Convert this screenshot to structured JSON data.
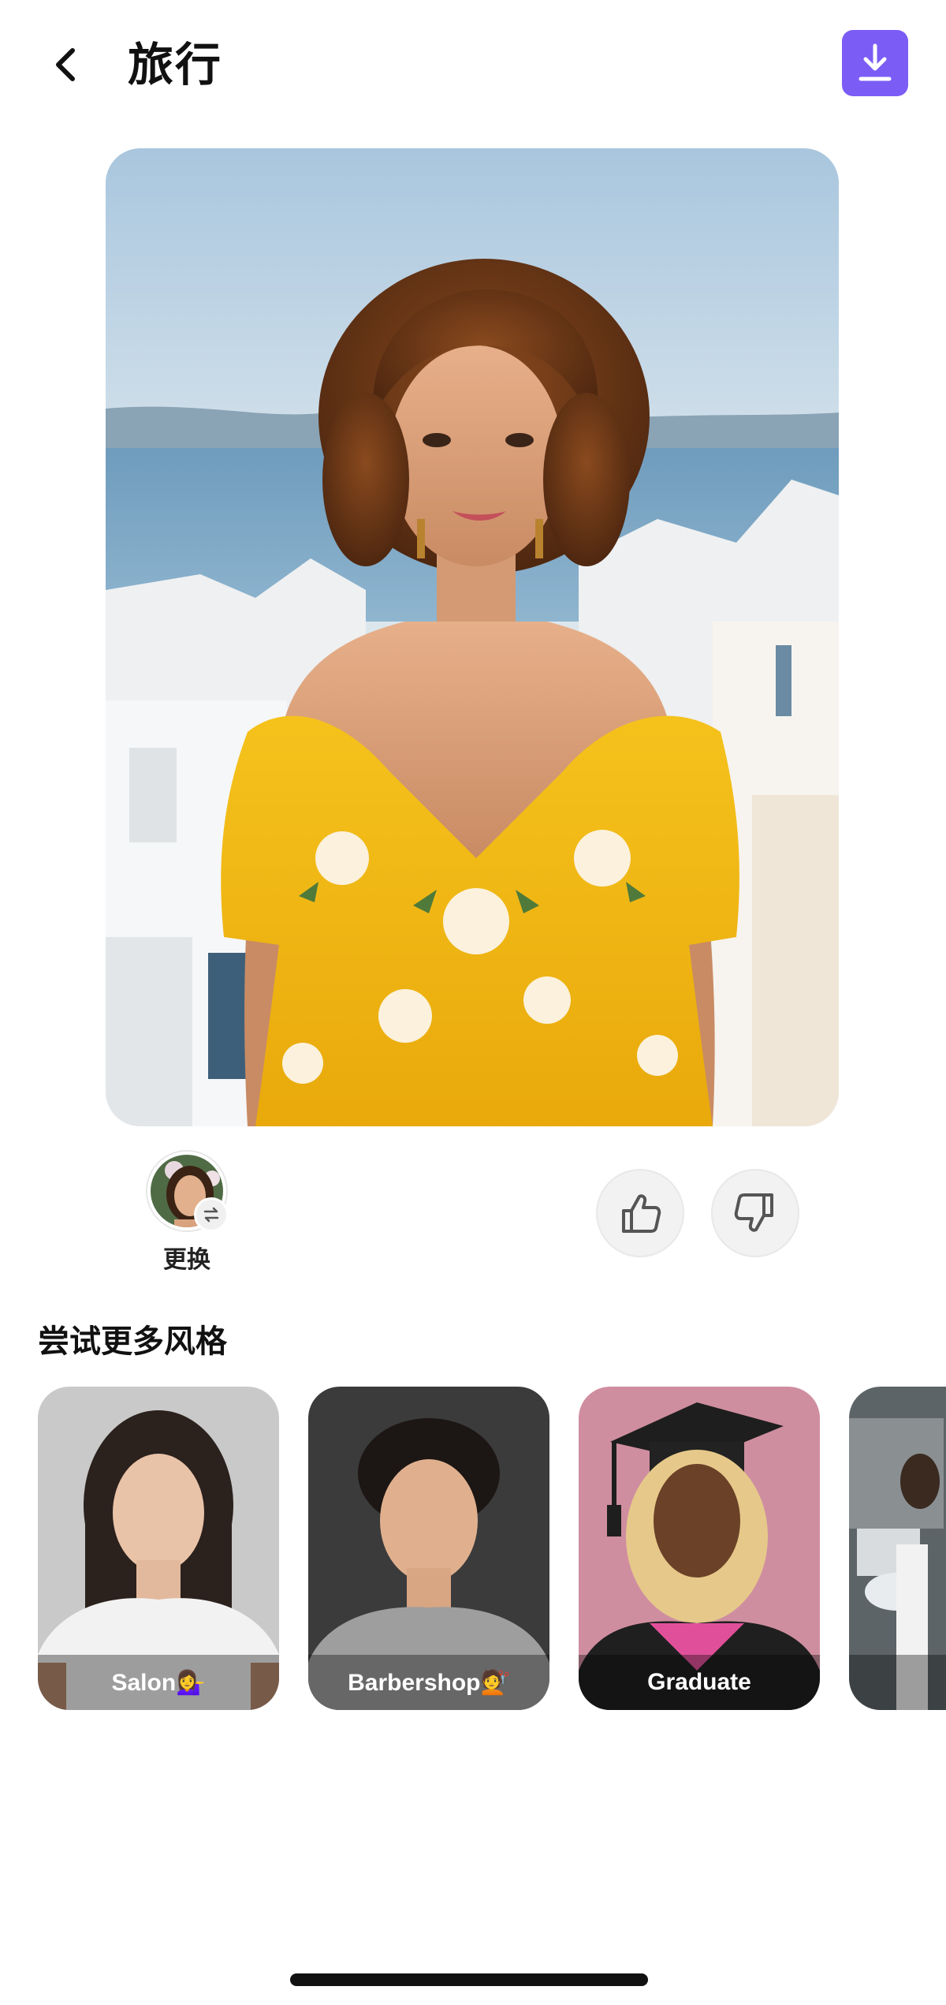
{
  "header": {
    "title": "旅行",
    "back_icon": "chevron-left-icon",
    "download_icon": "download-icon",
    "accent_color": "#7b5cf5"
  },
  "swap": {
    "label": "更换",
    "badge_icon": "swap-arrows-icon"
  },
  "feedback": {
    "like_icon": "thumbs-up-icon",
    "dislike_icon": "thumbs-down-icon"
  },
  "more_styles": {
    "title": "尝试更多风格",
    "cards": [
      {
        "label": "Salon💁‍♀️"
      },
      {
        "label": "Barbershop💇"
      },
      {
        "label": "Graduate"
      },
      {
        "label": ""
      }
    ]
  }
}
